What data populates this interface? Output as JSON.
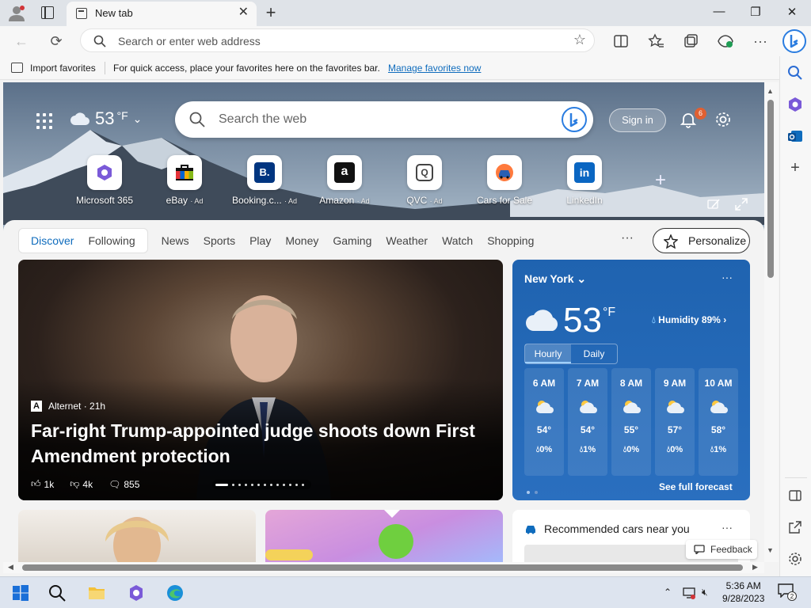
{
  "browser": {
    "tab_title": "New tab",
    "address_placeholder": "Search or enter web address",
    "window_controls": {
      "minimize": "—",
      "restore": "❐",
      "close": "✕"
    }
  },
  "favorites_bar": {
    "import_label": "Import favorites",
    "message": "For quick access, place your favorites here on the favorites bar.",
    "manage_link": "Manage favorites now"
  },
  "hero_header": {
    "weather_temp": "53",
    "weather_unit": "°F",
    "search_placeholder": "Search the web",
    "signin_label": "Sign in",
    "notification_count": "6"
  },
  "tiles": [
    {
      "label": "Microsoft 365",
      "ad": ""
    },
    {
      "label": "eBay",
      "ad": "· Ad"
    },
    {
      "label": "Booking.c...",
      "ad": "· Ad"
    },
    {
      "label": "Amazon",
      "ad": "· Ad"
    },
    {
      "label": "QVC",
      "ad": "· Ad"
    },
    {
      "label": "Cars for Sale",
      "ad": ""
    },
    {
      "label": "LinkedIn",
      "ad": ""
    }
  ],
  "feed_nav": {
    "items": [
      "Discover",
      "Following",
      "News",
      "Sports",
      "Play",
      "Money",
      "Gaming",
      "Weather",
      "Watch",
      "Shopping"
    ],
    "more": "···",
    "personalize": "Personalize"
  },
  "hero_card": {
    "source": "Alternet · 21h",
    "headline": "Far-right Trump-appointed judge shoots down First Amendment protection",
    "likes": "1k",
    "dislikes": "4k",
    "comments": "855"
  },
  "weather_card": {
    "city": "New York",
    "temp": "53",
    "unit": "°F",
    "humidity": "Humidity 89%",
    "tab_hourly": "Hourly",
    "tab_daily": "Daily",
    "hours": [
      {
        "time": "6 AM",
        "temp": "54°",
        "precip": "0%"
      },
      {
        "time": "7 AM",
        "temp": "54°",
        "precip": "1%"
      },
      {
        "time": "8 AM",
        "temp": "55°",
        "precip": "0%"
      },
      {
        "time": "9 AM",
        "temp": "57°",
        "precip": "0%"
      },
      {
        "time": "10 AM",
        "temp": "58°",
        "precip": "1%"
      }
    ],
    "forecast_link": "See full forecast"
  },
  "cars_card": {
    "title": "Recommended cars near you"
  },
  "feedback_label": "Feedback",
  "taskbar": {
    "time": "5:36 AM",
    "date": "9/28/2023",
    "notifications": "2"
  },
  "colors": {
    "accent": "#0f6cbd",
    "weather_bg": "#1f63b0",
    "badge": "#e06032"
  }
}
